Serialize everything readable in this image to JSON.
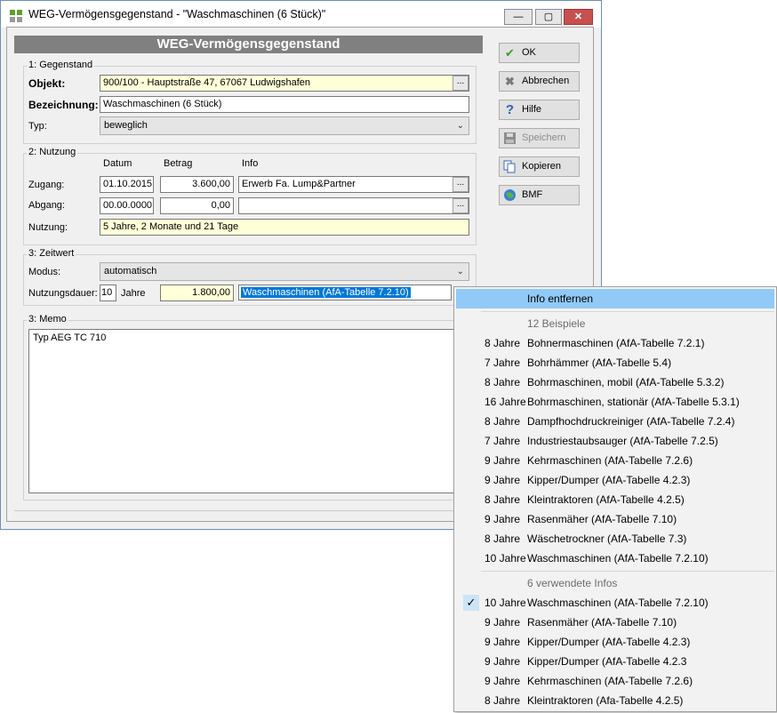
{
  "window": {
    "title": "WEG-Vermögensgegenstand - \"Waschmaschinen (6 Stück)\"",
    "header": "WEG-Vermögensgegenstand",
    "min_glyph": "—",
    "max_glyph": "▢",
    "close_glyph": "✕"
  },
  "gegenstand": {
    "title": "1: Gegenstand",
    "objekt_label": "Objekt:",
    "objekt_value": "900/100 - Hauptstraße 47, 67067 Ludwigshafen",
    "bezeichnung_label": "Bezeichnung:",
    "bezeichnung_value": "Waschmaschinen (6 Stück)",
    "typ_label": "Typ:",
    "typ_value": "beweglich"
  },
  "nutzung": {
    "title": "2: Nutzung",
    "col_datum": "Datum",
    "col_betrag": "Betrag",
    "col_info": "Info",
    "zugang_label": "Zugang:",
    "zugang_datum": "01.10.2015",
    "zugang_betrag": "3.600,00",
    "zugang_info": "Erwerb Fa. Lump&Partner",
    "abgang_label": "Abgang:",
    "abgang_datum": "00.00.0000",
    "abgang_betrag": "0,00",
    "abgang_info": "",
    "nutzung_label": "Nutzung:",
    "nutzung_value": "5 Jahre, 2 Monate und 21 Tage"
  },
  "zeitwert": {
    "title": "3: Zeitwert",
    "modus_label": "Modus:",
    "modus_value": "automatisch",
    "dauer_label": "Nutzungsdauer:",
    "dauer_value": "10",
    "jahre_label": "Jahre",
    "betrag_value": "1.800,00",
    "info_value": "Waschmaschinen (AfA-Tabelle 7.2.10)"
  },
  "memo": {
    "title": "3: Memo",
    "text": "Typ AEG TC 710"
  },
  "buttons": {
    "ok": "OK",
    "abbrechen": "Abbrechen",
    "hilfe": "Hilfe",
    "speichern": "Speichern",
    "kopieren": "Kopieren",
    "bmf": "BMF"
  },
  "dots": "...",
  "menu": {
    "remove_label": "Info entfernen",
    "examples_header": "12 Beispiele",
    "examples": [
      {
        "years": "8 Jahre",
        "name": "Bohnermaschinen (AfA-Tabelle 7.2.1)"
      },
      {
        "years": "7 Jahre",
        "name": "Bohrhämmer (AfA-Tabelle 5.4)"
      },
      {
        "years": "8 Jahre",
        "name": "Bohrmaschinen, mobil (AfA-Tabelle 5.3.2)"
      },
      {
        "years": "16 Jahre",
        "name": "Bohrmaschinen, stationär (AfA-Tabelle 5.3.1)"
      },
      {
        "years": "8 Jahre",
        "name": "Dampfhochdruckreiniger (AfA-Tabelle 7.2.4)"
      },
      {
        "years": "7 Jahre",
        "name": "Industriestaubsauger (AfA-Tabelle 7.2.5)"
      },
      {
        "years": "9 Jahre",
        "name": "Kehrmaschinen (AfA-Tabelle 7.2.6)"
      },
      {
        "years": "9 Jahre",
        "name": "Kipper/Dumper (AfA-Tabelle 4.2.3)"
      },
      {
        "years": "8 Jahre",
        "name": "Kleintraktoren (AfA-Tabelle 4.2.5)"
      },
      {
        "years": "9 Jahre",
        "name": "Rasenmäher (AfA-Tabelle 7.10)"
      },
      {
        "years": "8 Jahre",
        "name": "Wäschetrockner (AfA-Tabelle 7.3)"
      },
      {
        "years": "10 Jahre",
        "name": "Waschmaschinen (AfA-Tabelle 7.2.10)"
      }
    ],
    "used_header": "6 verwendete Infos",
    "used": [
      {
        "years": "10 Jahre",
        "name": "Waschmaschinen (AfA-Tabelle 7.2.10)",
        "checked": true
      },
      {
        "years": "9 Jahre",
        "name": "Rasenmäher (AfA-Tabelle 7.10)"
      },
      {
        "years": "9 Jahre",
        "name": "Kipper/Dumper (AfA-Tabelle 4.2.3)"
      },
      {
        "years": "9 Jahre",
        "name": "Kipper/Dumper (AfA-Tabelle 4.2.3"
      },
      {
        "years": "9 Jahre",
        "name": "Kehrmaschinen (AfA-Tabelle 7.2.6)"
      },
      {
        "years": "8 Jahre",
        "name": "Kleintraktoren (Afa-Tabelle 4.2.5)"
      }
    ],
    "check_glyph": "✓"
  },
  "colors": {
    "accent": "#0078d7",
    "header_bar": "#808080",
    "yellow_field": "#ffffd8",
    "menu_highlight": "#91c9f7"
  }
}
